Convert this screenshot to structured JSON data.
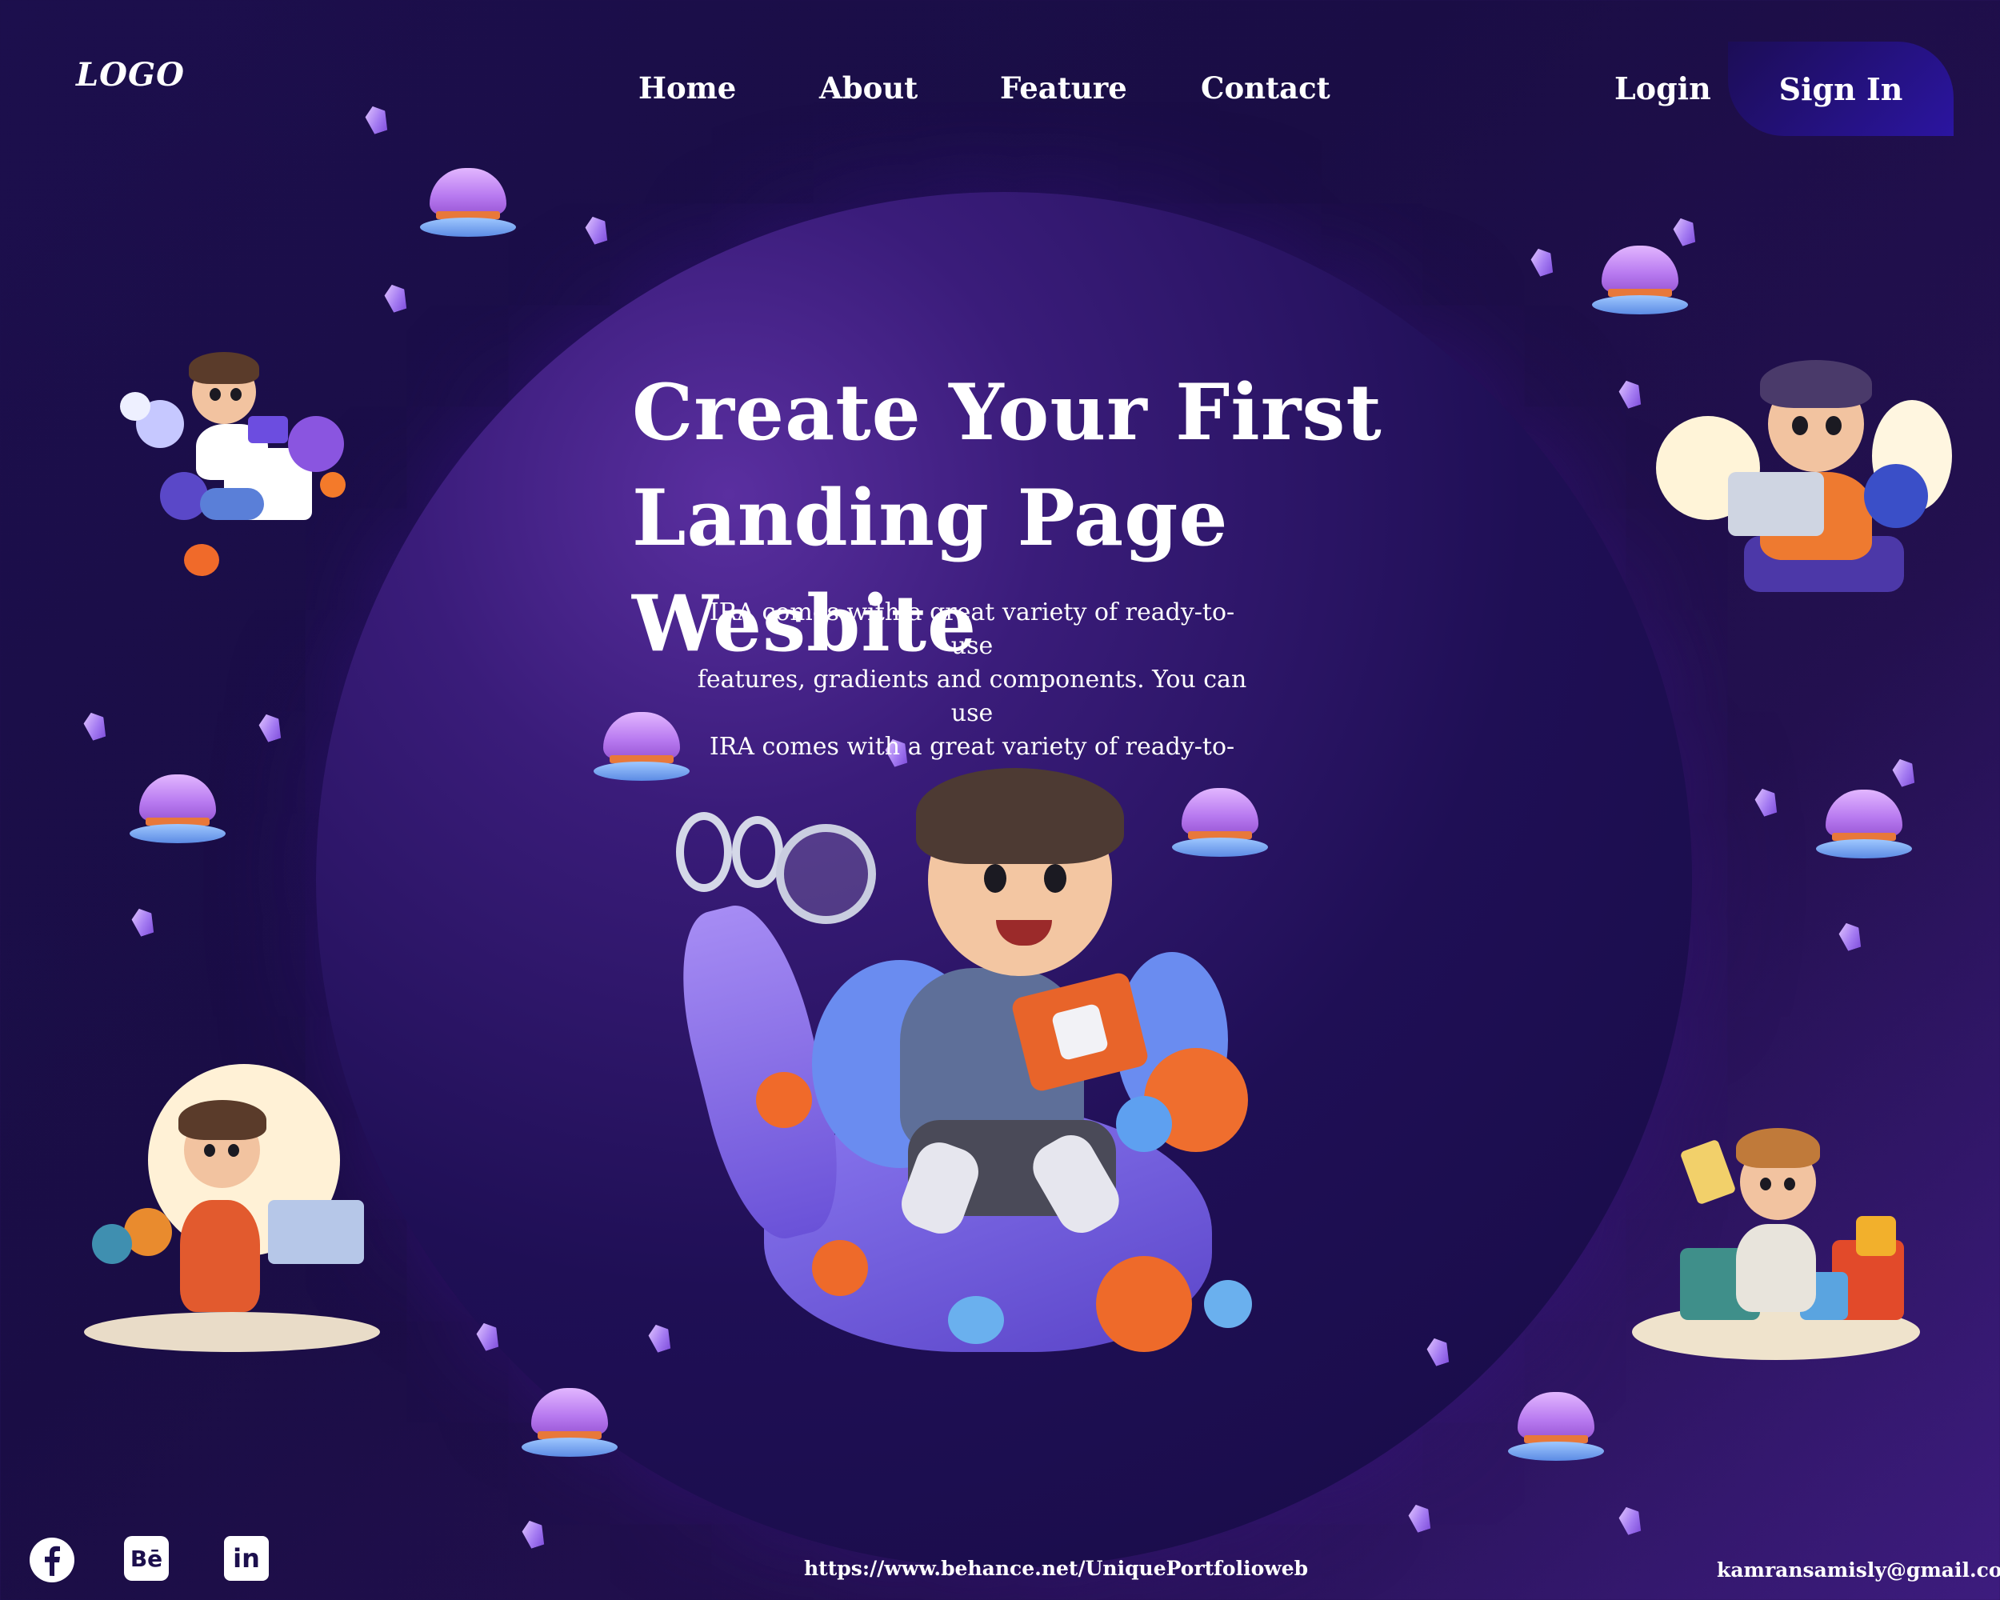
{
  "nav": {
    "logo": "LOGO",
    "links": [
      "Home",
      "About",
      "Feature",
      "Contact"
    ],
    "login": "Login",
    "sign_in": "Sign In"
  },
  "hero": {
    "title_line1": "Create Your First",
    "title_line2": "Landing Page Wesbite",
    "desc_line1": "IRA comes with a great variety of ready-to-use",
    "desc_line2": "features, gradients and components. You can use",
    "desc_line3": "IRA comes with a great variety of ready-to-"
  },
  "footer": {
    "social": [
      "facebook-icon",
      "behance-icon",
      "linkedin-icon"
    ],
    "behance_text": "Bē",
    "linkedin_text": "in",
    "portfolio_link": "https://www.behance.net/UniquePortfolioweb",
    "email": "kamransamisly@gmail.com"
  },
  "colors": {
    "background": "#1c0f4d",
    "accent": "#2b15a0",
    "crystal": "#a57cf2",
    "text": "#ffffff"
  }
}
